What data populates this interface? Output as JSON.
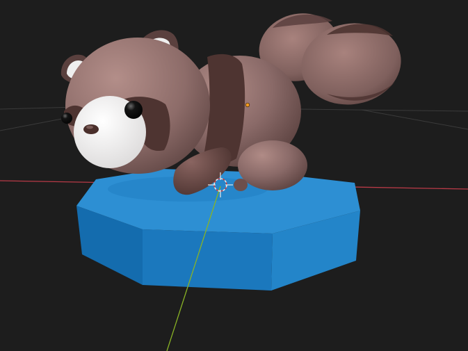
{
  "viewport": {
    "background": "#1d1d1d",
    "grid_color": "#3a3a3a",
    "x_axis_color": "#b83a47",
    "y_axis_color": "#89b325"
  },
  "scene": {
    "pedestal": {
      "shape": "octagonal-prism",
      "top_color": "#2d8fd3",
      "side_color": "#1f7fc4",
      "dark_side_color": "#146cae"
    },
    "raccoon": {
      "fur_color": "#8a6a68",
      "fur_highlight": "#a7847f",
      "dark_band_color": "#4e3431",
      "face_white": "#f0f0f0",
      "eye_color": "#0c0c0c",
      "nose_color": "#4a2f2b"
    },
    "origin_dot_color": "#f29a1f",
    "cursor_icon": "3d-cursor-icon"
  }
}
